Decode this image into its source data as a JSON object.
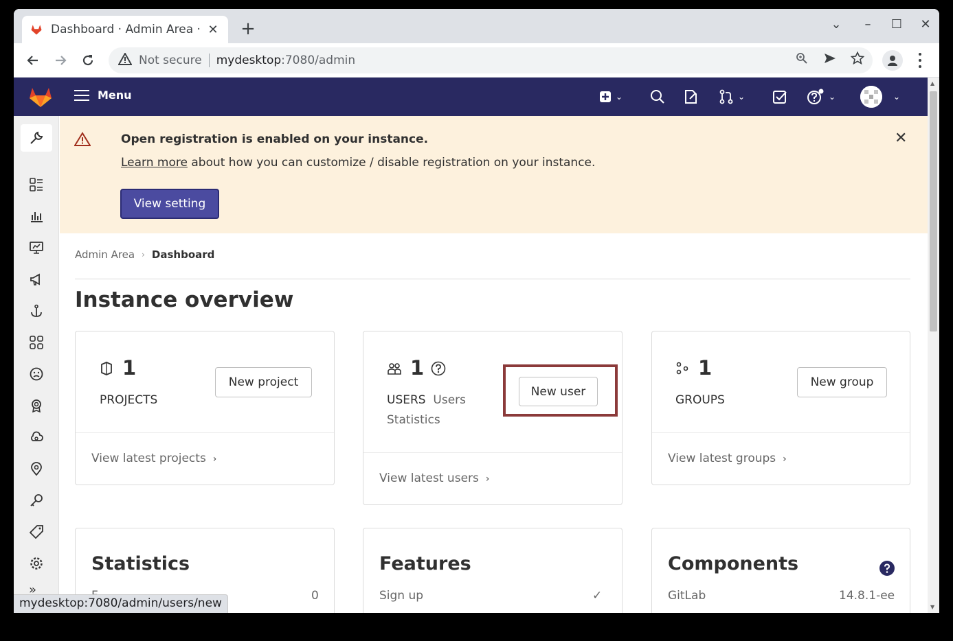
{
  "browser": {
    "tab_title": "Dashboard · Admin Area ·",
    "url_warning": "Not secure",
    "url_host": "mydesktop",
    "url_path": ":7080/admin",
    "status_url": "mydesktop:7080/admin/users/new"
  },
  "header": {
    "menu_label": "Menu"
  },
  "banner": {
    "title": "Open registration is enabled on your instance.",
    "link_text": "Learn more",
    "body_text": " about how you can customize / disable registration on your instance.",
    "button_label": "View setting"
  },
  "breadcrumb": {
    "parent": "Admin Area",
    "current": "Dashboard"
  },
  "page_title": "Instance overview",
  "cards": {
    "projects": {
      "count": "1",
      "label": "PROJECTS",
      "button": "New project",
      "link": "View latest projects"
    },
    "users": {
      "count": "1",
      "label": "USERS",
      "stats_link_1": "Users",
      "stats_link_2": "Statistics",
      "button": "New user",
      "link": "View latest users"
    },
    "groups": {
      "count": "1",
      "label": "GROUPS",
      "button": "New group",
      "link": "View latest groups"
    }
  },
  "statistics": {
    "title": "Statistics",
    "row_label": "F",
    "row_value": "0"
  },
  "features": {
    "title": "Features",
    "row_label": "Sign up",
    "row_value": "✓"
  },
  "components": {
    "title": "Components",
    "row_label": "GitLab",
    "row_value": "14.8.1-ee"
  },
  "colors": {
    "header_bg": "#292961",
    "banner_bg": "#fdf1dd",
    "primary_button": "#4b4ba0",
    "highlight_box": "#8b3a3a"
  }
}
